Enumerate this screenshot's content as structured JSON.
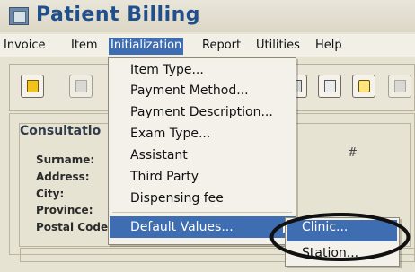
{
  "window": {
    "title": "Patient Billing"
  },
  "menubar": {
    "items": [
      {
        "label": "Invoice"
      },
      {
        "label": "Item"
      },
      {
        "label": "Initialization",
        "active": true
      },
      {
        "label": "Report"
      },
      {
        "label": "Utilities"
      },
      {
        "label": "Help"
      }
    ]
  },
  "panel": {
    "section_title": "Consultatio",
    "fields": [
      {
        "label": "Surname:"
      },
      {
        "label": "Address:"
      },
      {
        "label": "City:"
      },
      {
        "label": "Province:"
      },
      {
        "label": "Postal Code"
      }
    ],
    "hash_text": "#"
  },
  "dropdown": {
    "items": [
      "Item Type...",
      "Payment Method...",
      "Payment Description...",
      "Exam Type...",
      "Assistant",
      "Third Party",
      "Dispensing fee"
    ],
    "default_values": "Default Values...",
    "arrow": "▶"
  },
  "submenu": {
    "items": [
      {
        "label": "Clinic...",
        "highlighted": true
      },
      {
        "label": "Station..."
      }
    ]
  },
  "colors": {
    "accent": "#3f6db2",
    "title": "#1f4f8c",
    "annotation": "#111111"
  }
}
